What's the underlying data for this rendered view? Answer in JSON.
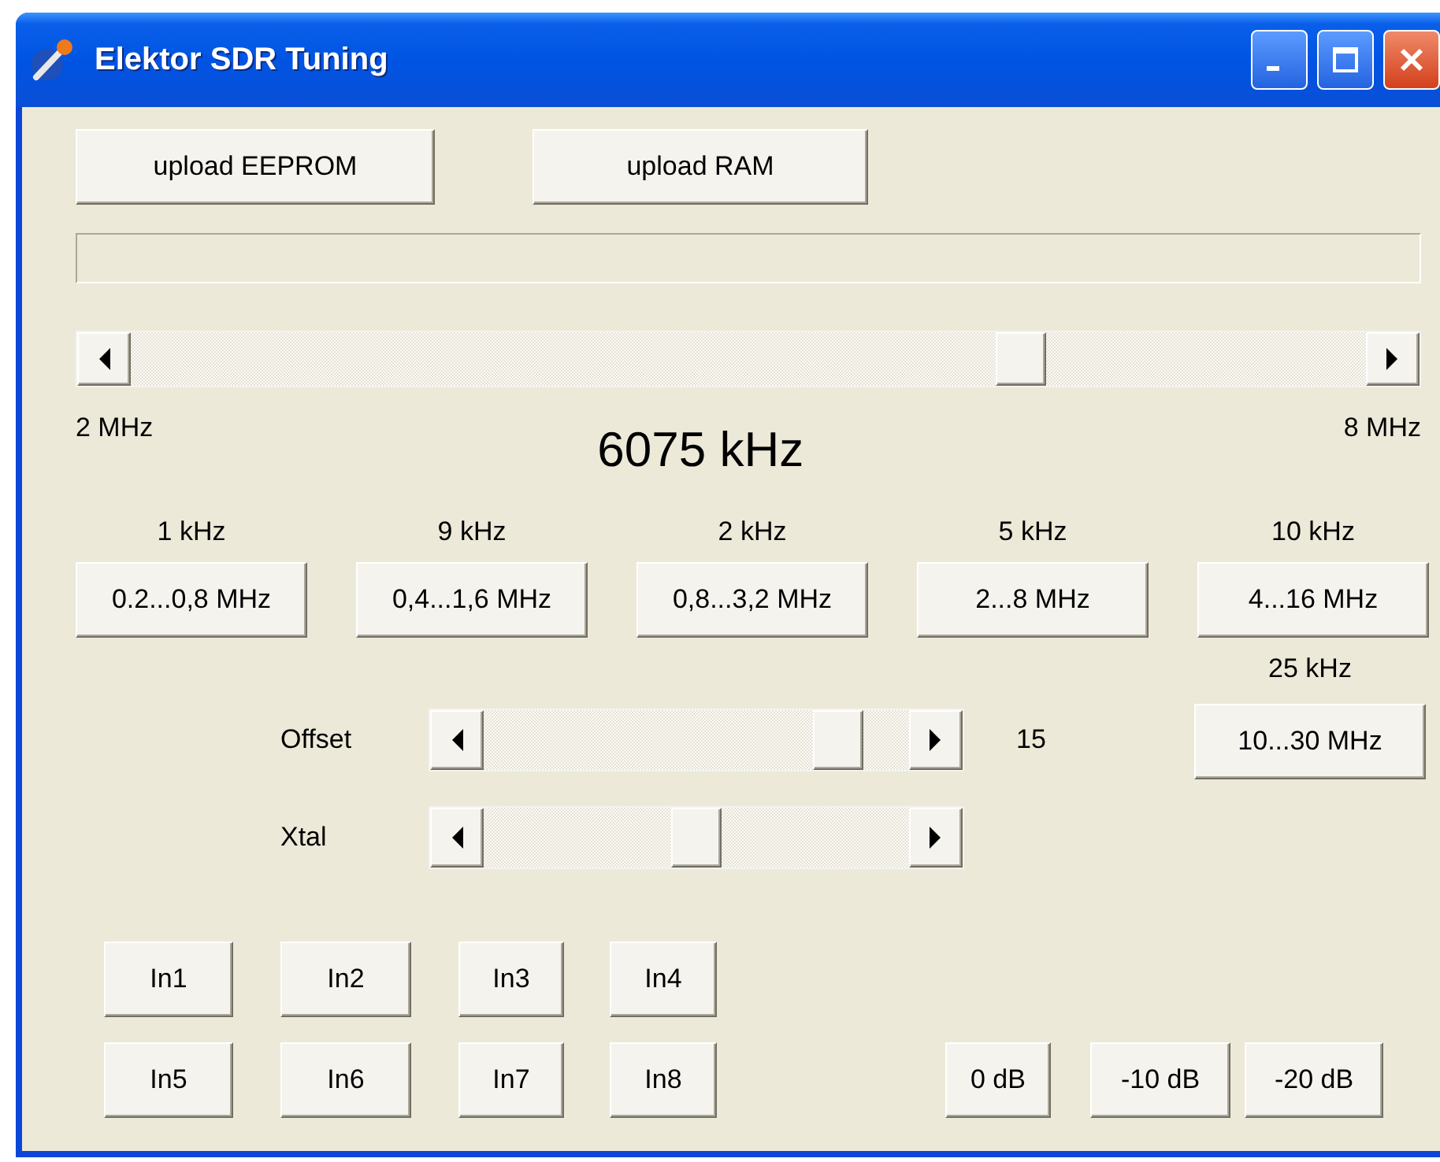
{
  "window": {
    "title": "Elektor SDR Tuning"
  },
  "upload_buttons": [
    "upload EEPROM",
    "upload RAM"
  ],
  "progress": {
    "level": 0
  },
  "tuning": {
    "level": 0.73,
    "min_label": "2 MHz",
    "frequency": "6075 kHz",
    "max_label": "8 MHz"
  },
  "bands": [
    {
      "step": "1 kHz",
      "range": "0.2...0,8 MHz"
    },
    {
      "step": "9 kHz",
      "range": "0,4...1,6 MHz"
    },
    {
      "step": "2 kHz",
      "range": "0,8...3,2 MHz"
    },
    {
      "step": "5 kHz",
      "range": "2...8 MHz"
    },
    {
      "step": "10 kHz",
      "range": "4...16 MHz"
    },
    {
      "step": "25 kHz",
      "range": "10...30 MHz"
    }
  ],
  "offset": {
    "label": "Offset",
    "level": 0.88,
    "value": "15"
  },
  "xtal": {
    "label": "Xtal",
    "level": 0.5
  },
  "inputs": [
    "In1",
    "In2",
    "In3",
    "In4",
    "In5",
    "In6",
    "In7",
    "In8"
  ],
  "attenuators": [
    "0 dB",
    "-10 dB",
    "-20 dB"
  ]
}
